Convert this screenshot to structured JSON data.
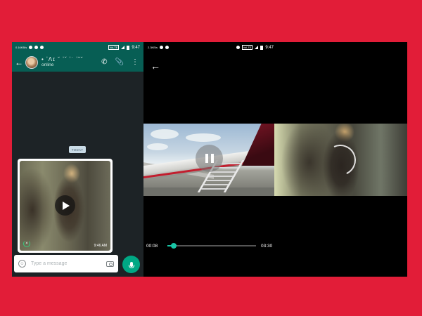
{
  "left_status": {
    "left_text": "0.16KB/s",
    "time": "9:47",
    "volte": "VoLTE"
  },
  "right_status": {
    "left_text": "2.3KB/s",
    "time": "9:47",
    "volte": "VoLTE"
  },
  "chat_header": {
    "contact_name": "• ʼɅɪ ˘ ʼˇ ʼ˙ ʼ˘˘",
    "status": "online"
  },
  "chat": {
    "date_chip": "TODAY",
    "video_message": {
      "time": "9:46 AM"
    }
  },
  "composer": {
    "placeholder": "Type a message"
  },
  "player": {
    "current_time": "00:08",
    "total_time": "03:30",
    "progress_fraction": 0.04
  },
  "colors": {
    "background": "#e21d38",
    "whatsapp_green": "#075e54",
    "accent": "#00a884",
    "seek_accent": "#18c6a6"
  },
  "icons": [
    "back-arrow-icon",
    "phone-icon",
    "paperclip-icon",
    "menu-dots-icon",
    "emoji-icon",
    "camera-icon",
    "mic-icon",
    "play-icon",
    "pause-icon",
    "loading-spinner-icon"
  ]
}
